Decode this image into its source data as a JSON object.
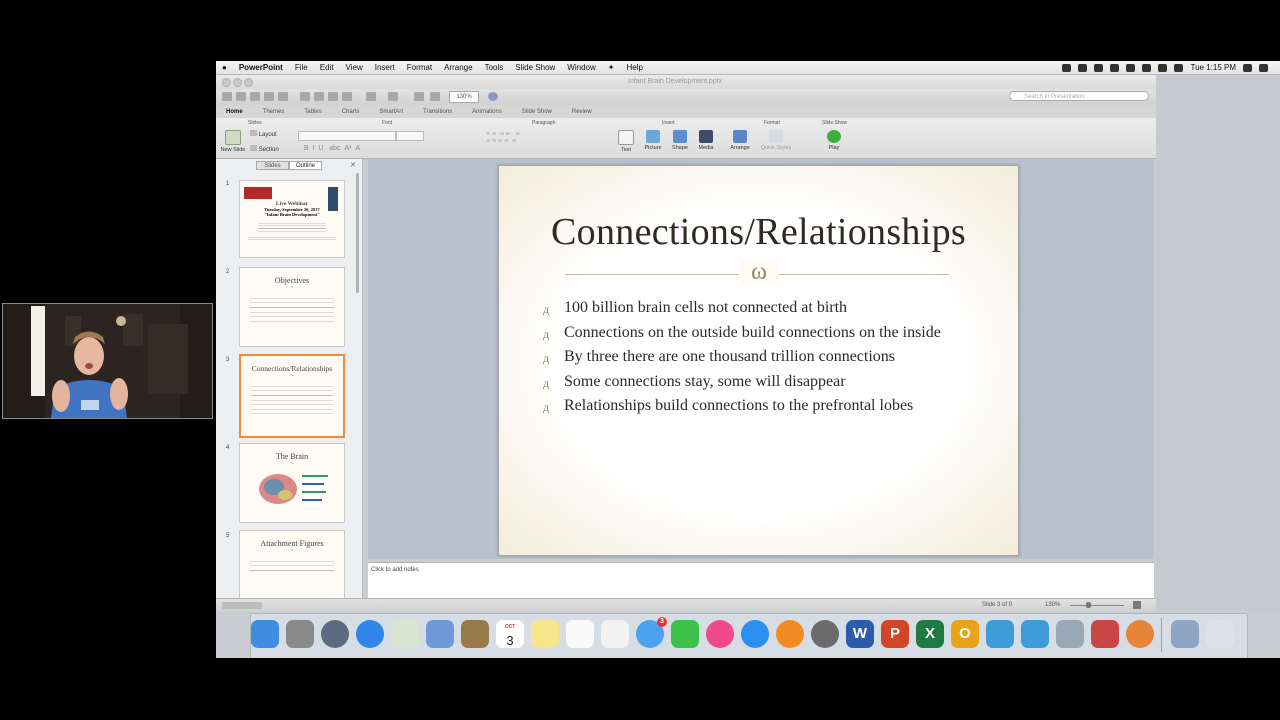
{
  "menubar": {
    "app": "PowerPoint",
    "items": [
      "File",
      "Edit",
      "View",
      "Insert",
      "Format",
      "Arrange",
      "Tools",
      "Slide Show",
      "Window",
      "Help"
    ],
    "clock": "Tue 1:15 PM"
  },
  "window": {
    "title": "Infant Brain Development.pptx"
  },
  "toolbar": {
    "zoom": "130%",
    "search_placeholder": "Search in Presentation"
  },
  "ribbon_tabs": [
    "Home",
    "Themes",
    "Tables",
    "Charts",
    "SmartArt",
    "Transitions",
    "Animations",
    "Slide Show",
    "Review"
  ],
  "ribbon": {
    "groups": {
      "slides": "Slides",
      "font": "Font",
      "paragraph": "Paragraph",
      "insert": "Insert",
      "format": "Format",
      "slideshow": "Slide Show"
    },
    "new_slide": "New Slide",
    "layout": "Layout",
    "section": "Section",
    "text": "Text",
    "picture": "Picture",
    "shape": "Shape",
    "media": "Media",
    "arrange": "Arrange",
    "quick_styles": "Quick Styles",
    "play": "Play"
  },
  "panel": {
    "tabs": [
      "Slides",
      "Outline"
    ],
    "thumbs": [
      {
        "num": "1",
        "title": "Live Webinar",
        "lines": [
          "Tuesday, September 26, 2017",
          "\"Infant Brain Development\""
        ]
      },
      {
        "num": "2",
        "title": "Objectives"
      },
      {
        "num": "3",
        "title": "Connections/Relationships"
      },
      {
        "num": "4",
        "title": "The Brain"
      },
      {
        "num": "5",
        "title": "Attachment Figures"
      }
    ]
  },
  "slide": {
    "title": "Connections/Relationships",
    "ornament": "ω",
    "bullets": [
      "100 billion brain cells not connected at birth",
      "Connections on the outside build connections on the inside",
      "By three there are one thousand trillion connections",
      "Some connections stay, some will disappear",
      "Relationships build connections to the prefrontal lobes"
    ]
  },
  "notes": {
    "placeholder": "Click to add notes"
  },
  "status": {
    "slide_of": "Slide 3 of 9",
    "zoom": "130%"
  },
  "dock": {
    "calendar_month": "OCT",
    "calendar_day": "3",
    "messages_badge": "3",
    "word_letter": "W",
    "powerpoint_letter": "P",
    "excel_letter": "X",
    "outlook_letter": "O"
  }
}
